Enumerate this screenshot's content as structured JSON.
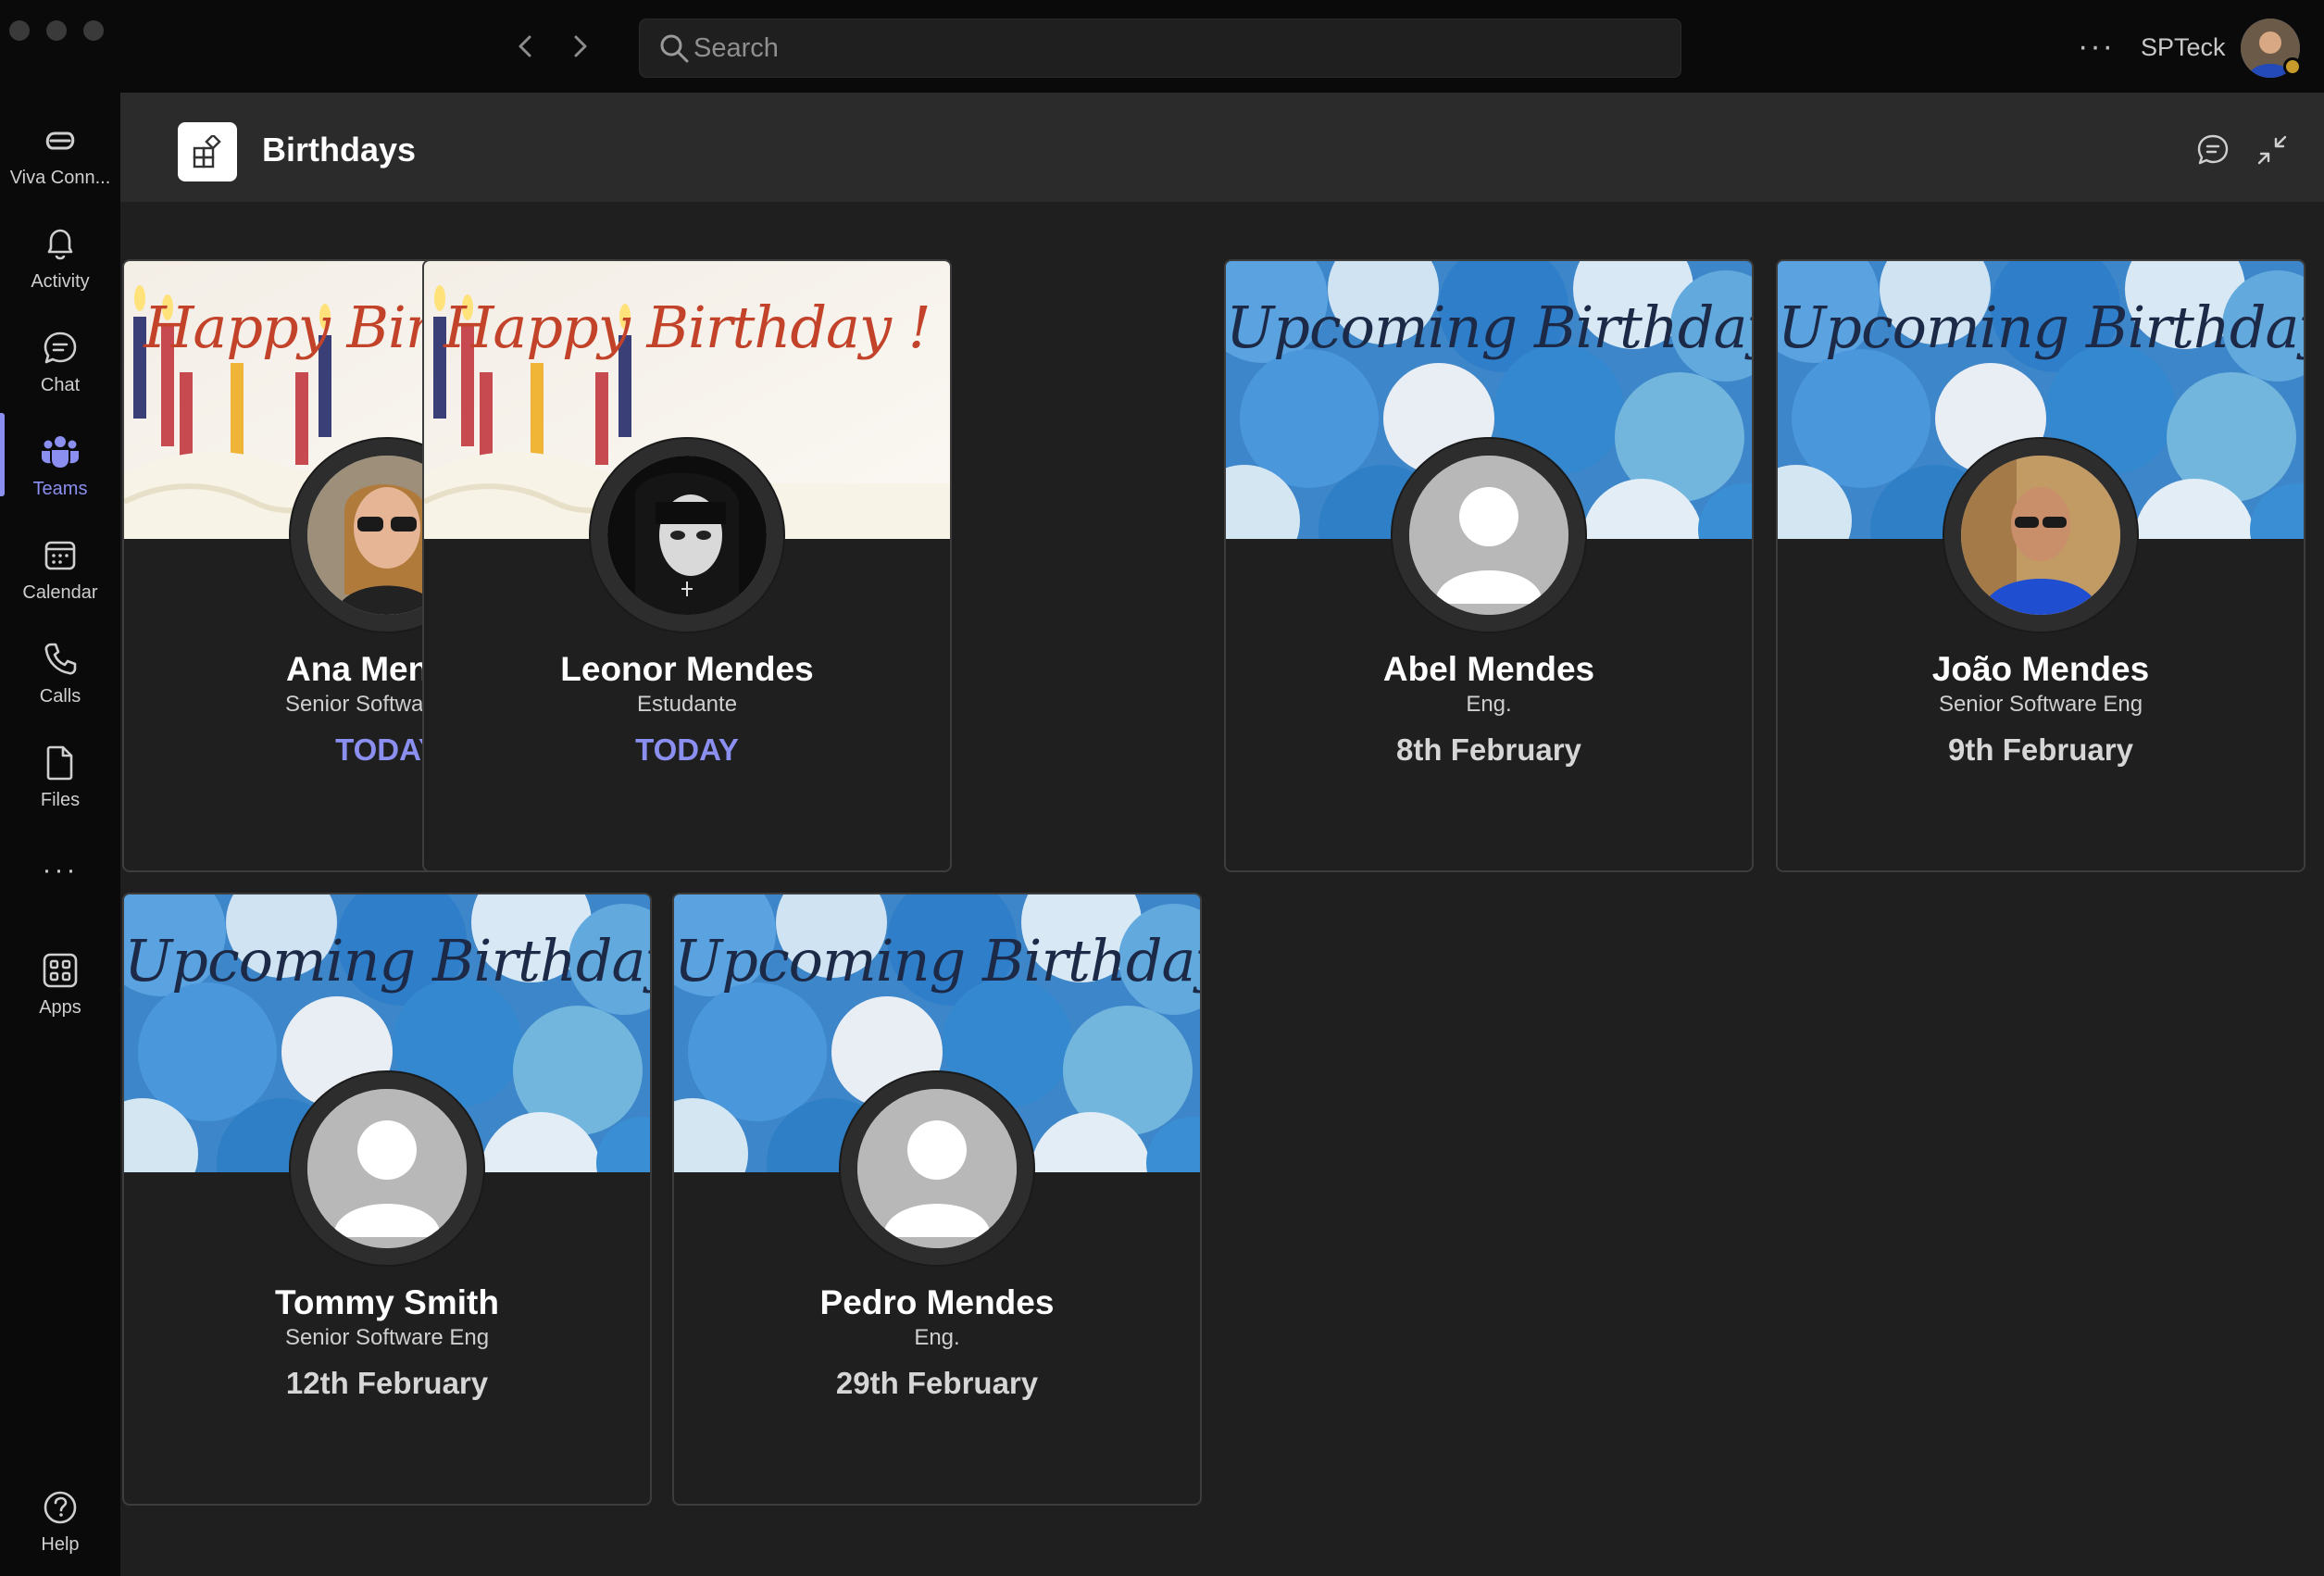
{
  "search": {
    "placeholder": "Search"
  },
  "topbar": {
    "more": "···",
    "tenant": "SPTeck"
  },
  "rail": {
    "items": [
      {
        "label": "Viva Conn...",
        "icon": "viva-connections-icon"
      },
      {
        "label": "Activity",
        "icon": "bell-icon"
      },
      {
        "label": "Chat",
        "icon": "chat-icon"
      },
      {
        "label": "Teams",
        "icon": "teams-icon",
        "active": true
      },
      {
        "label": "Calendar",
        "icon": "calendar-icon"
      },
      {
        "label": "Calls",
        "icon": "phone-icon"
      },
      {
        "label": "Files",
        "icon": "file-icon"
      },
      {
        "label": "Apps",
        "icon": "apps-icon"
      },
      {
        "label": "Help",
        "icon": "help-icon"
      }
    ],
    "more": "···"
  },
  "app": {
    "title": "Birthdays"
  },
  "cards": [
    {
      "banner": "Happy Birthday !",
      "name": "Ana Mendes",
      "title": "Senior Software Eng",
      "date": "TODAY"
    },
    {
      "banner": "Happy Birthday !",
      "name": "Leonor Mendes",
      "title": "Estudante",
      "date": "TODAY"
    },
    {
      "banner": "Upcoming Birthdays",
      "name": "Abel Mendes",
      "title": "Eng.",
      "date": "8th February"
    },
    {
      "banner": "Upcoming Birthdays",
      "name": "João Mendes",
      "title": "Senior Software Eng",
      "date": "9th February"
    },
    {
      "banner": "Upcoming Birthdays",
      "name": "Tommy Smith",
      "title": "Senior Software Eng",
      "date": "12th February"
    },
    {
      "banner": "Upcoming Birthdays",
      "name": "Pedro Mendes",
      "title": "Eng.",
      "date": "29th February"
    }
  ],
  "colors": {
    "accent": "#8b8ff0",
    "birthday_text": "#c3432a",
    "upcoming_text": "#1c2a47",
    "background": "#1f1f1f",
    "rail": "#0a0a0a"
  }
}
